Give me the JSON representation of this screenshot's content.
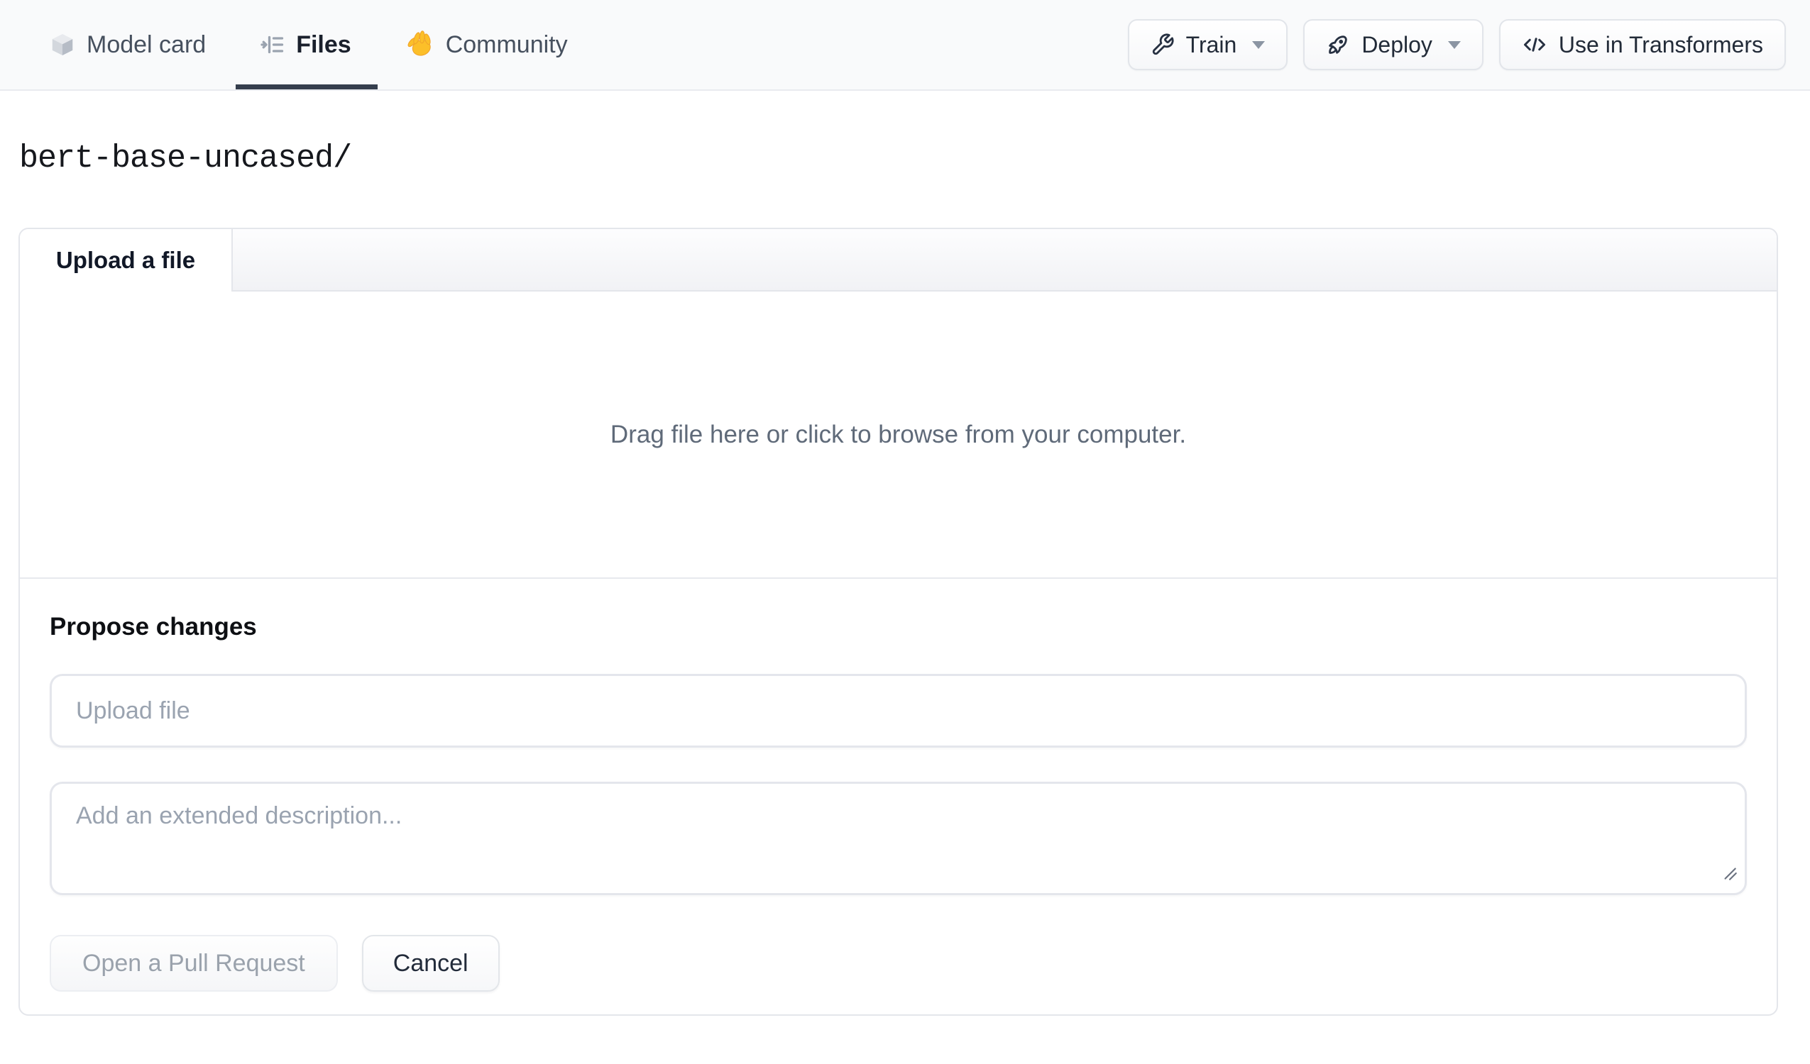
{
  "nav": {
    "tabs": [
      {
        "label": "Model card",
        "icon": "cube-icon",
        "active": false
      },
      {
        "label": "Files",
        "icon": "file-versions-icon",
        "active": true
      },
      {
        "label": "Community",
        "icon": "waving-hand-icon",
        "active": false
      }
    ],
    "actions": [
      {
        "label": "Train",
        "icon": "wrench-icon",
        "has_dropdown": true
      },
      {
        "label": "Deploy",
        "icon": "rocket-icon",
        "has_dropdown": true
      },
      {
        "label": "Use in Transformers",
        "icon": "code-icon",
        "has_dropdown": false
      }
    ]
  },
  "breadcrumb": {
    "path": "bert-base-uncased/"
  },
  "upload_panel": {
    "tab_label": "Upload a file",
    "dropzone_text": "Drag file here or click to browse from your computer.",
    "propose_heading": "Propose changes",
    "file_input_placeholder": "Upload file",
    "description_placeholder": "Add an extended description...",
    "primary_button": "Open a Pull Request",
    "cancel_button": "Cancel"
  },
  "colors": {
    "nav_bg": "#f9fafb",
    "active_tab_underline": "#353e4d",
    "panel_border": "#e4e6eb",
    "muted_text": "#5f6a79",
    "placeholder_text": "#9aa3b0",
    "disabled_button_text": "#9aa2ac",
    "dark_text": "#1a202c",
    "hand_emoji_yellow": "#fcbf29"
  }
}
